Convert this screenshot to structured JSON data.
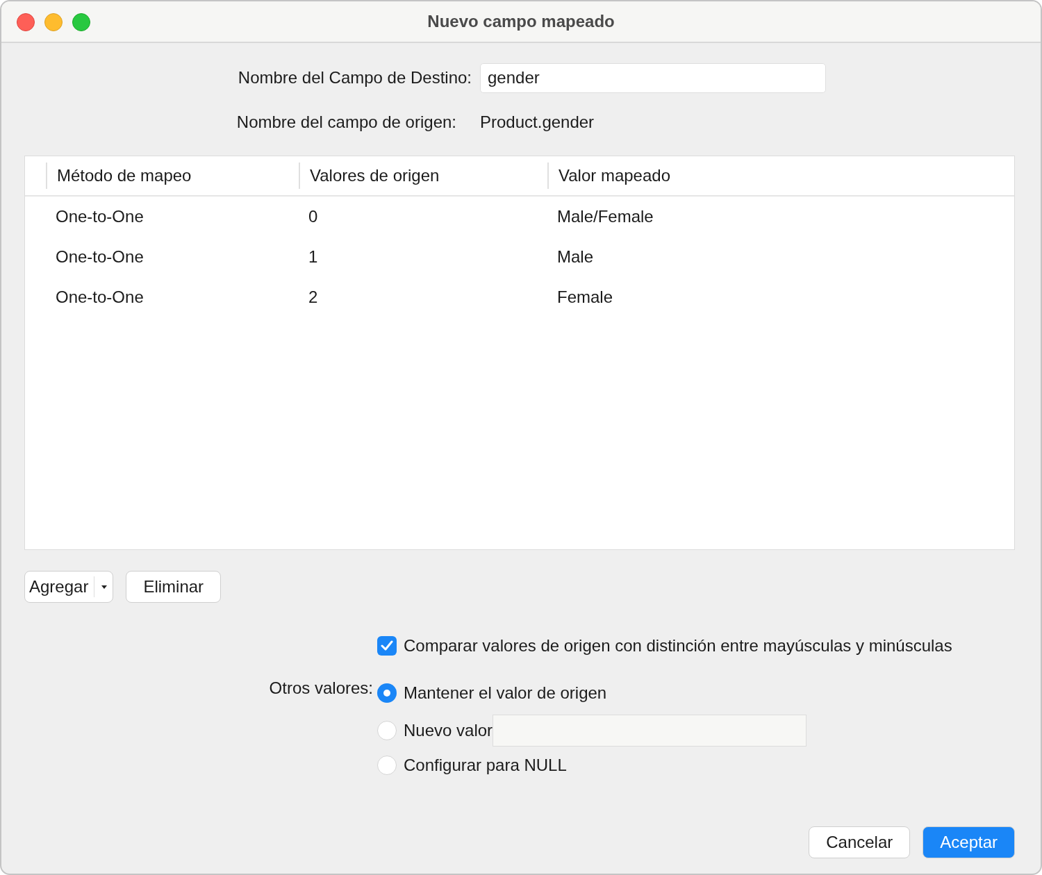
{
  "window": {
    "title": "Nuevo campo mapeado"
  },
  "target_field": {
    "label": "Nombre del Campo de Destino:",
    "value": "gender"
  },
  "source_field": {
    "label": "Nombre del campo de origen:",
    "value": "Product.gender"
  },
  "table": {
    "columns": [
      "Método de mapeo",
      "Valores de origen",
      "Valor mapeado"
    ],
    "rows": [
      [
        "One-to-One",
        "0",
        "Male/Female"
      ],
      [
        "One-to-One",
        "1",
        "Male"
      ],
      [
        "One-to-One",
        "2",
        "Female"
      ]
    ]
  },
  "table_buttons": {
    "add": "Agregar",
    "remove": "Eliminar"
  },
  "case_sensitive": {
    "label": "Comparar valores de origen con distinción entre mayúsculas y minúsculas",
    "checked": true
  },
  "other_values": {
    "label": "Otros valores:",
    "options": [
      {
        "label": "Mantener el valor de origen",
        "selected": true,
        "kind": "plain"
      },
      {
        "label": "Nuevo valor",
        "selected": false,
        "kind": "input"
      },
      {
        "label": "Configurar para NULL",
        "selected": false,
        "kind": "plain"
      }
    ]
  },
  "buttons": [
    {
      "label": "Cancelar",
      "kind": "secondary"
    },
    {
      "label": "Aceptar",
      "kind": "primary"
    }
  ]
}
